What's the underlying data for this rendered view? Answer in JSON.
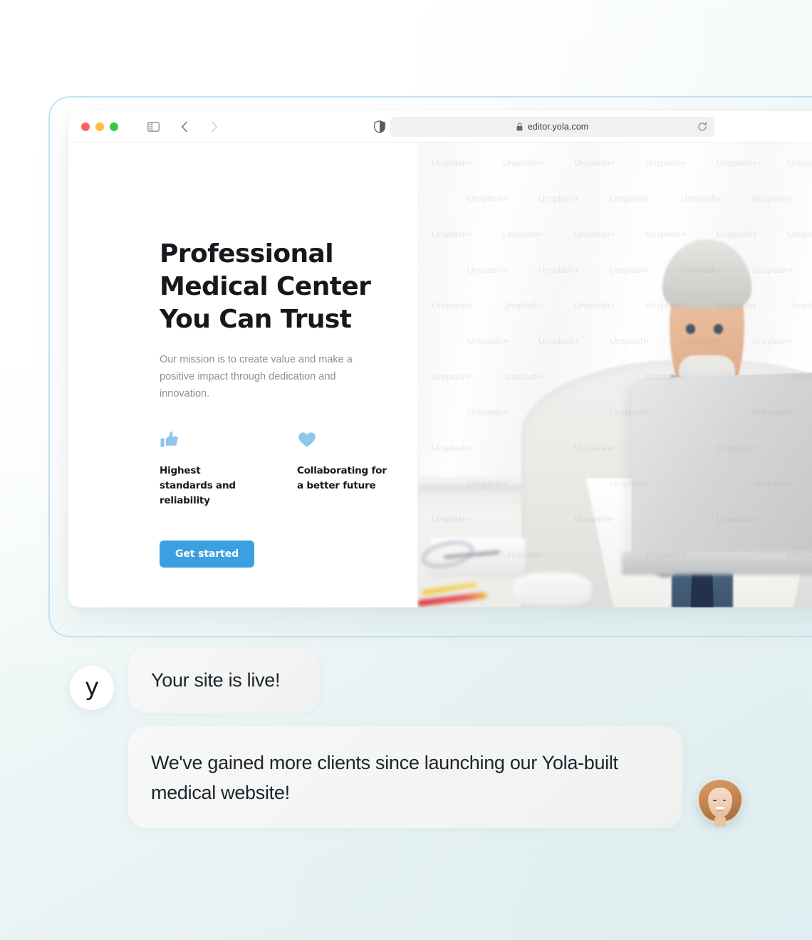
{
  "browser": {
    "url": "editor.yola.com",
    "icons": {
      "lock": "lock-icon",
      "reload": "reload-icon",
      "sidebar": "sidebar-toggle-icon",
      "back": "chevron-left-icon",
      "forward": "chevron-right-icon",
      "reader": "reader-mode-icon"
    },
    "traffic_lights": [
      "close",
      "minimize",
      "zoom"
    ]
  },
  "site": {
    "headline": "Professional Medical Center You Can Trust",
    "subcopy": "Our mission is to create value and make a positive impact through dedication and innovation.",
    "features": [
      {
        "icon": "thumbs-up-icon",
        "label": "Highest standards and reliability"
      },
      {
        "icon": "heart-icon",
        "label": "Collaborating for a better future"
      }
    ],
    "cta_label": "Get started",
    "hero_watermark": "Unsplash+"
  },
  "chat": {
    "brand_initial": "y",
    "message_1": "Your site is live!",
    "message_2": "We've gained more clients since launching our Yola-built medical website!"
  },
  "colors": {
    "accent_blue": "#3ba0e0",
    "icon_blue": "#8fc6ed",
    "heading": "#16181d",
    "body_text": "#8b8f95",
    "bubble": "#f3f4f4",
    "frame_border": "#c6e2f2"
  }
}
